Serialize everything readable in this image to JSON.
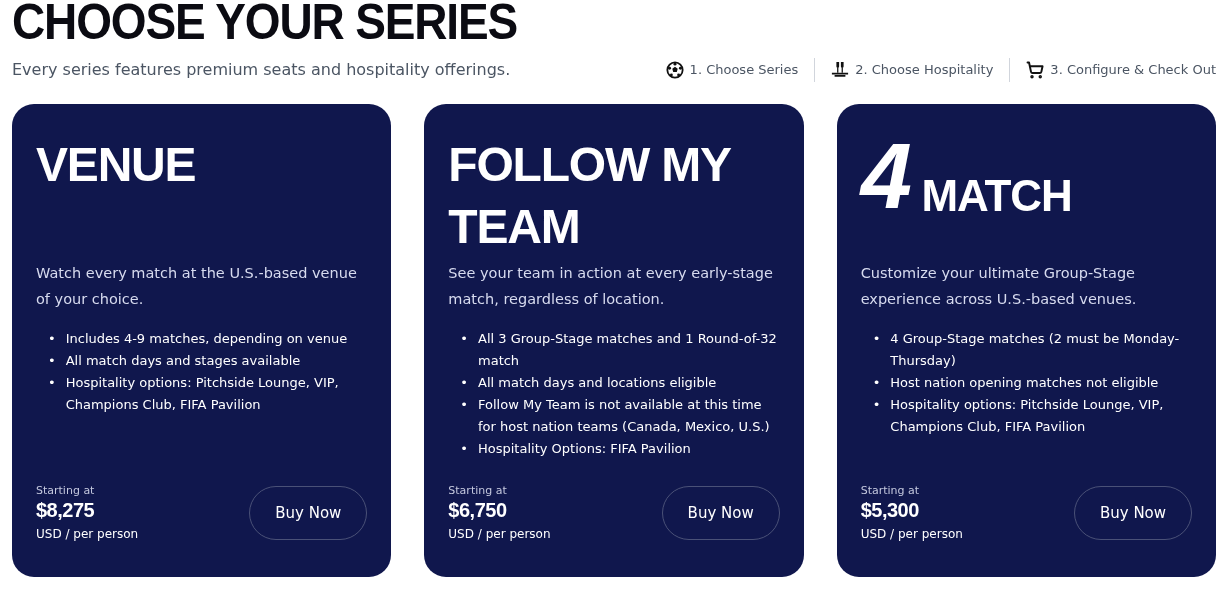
{
  "heading": "CHOOSE YOUR SERIES",
  "bullet": "•",
  "subtitle": "Every series features premium seats and hospitality offerings.",
  "steps": [
    {
      "kind": "ball",
      "label": "1. Choose Series"
    },
    {
      "kind": "glasses",
      "label": "2. Choose Hospitality"
    },
    {
      "kind": "cart",
      "label": "3. Configure & Check Out"
    }
  ],
  "cards": [
    {
      "title": "VENUE",
      "description": "Watch every match at the U.S.-based venue of your choice.",
      "bullets": [
        "Includes 4-9 matches, depending on venue",
        "All match days and stages available",
        "Hospitality options: Pitchside Lounge, VIP, Champions Club, FIFA Pavilion"
      ],
      "price_label": "Starting at",
      "price": "$8,275",
      "price_unit": "USD / per person",
      "button": "Buy Now"
    },
    {
      "title": "FOLLOW MY TEAM",
      "description": "See your team in action at every early-stage match, regardless of location.",
      "bullets": [
        "All 3 Group-Stage matches and 1 Round-of-32 match",
        "All match days and locations eligible",
        "Follow My Team is not available at this time for host nation teams (Canada, Mexico, U.S.)",
        "Hospitality Options: FIFA Pavilion"
      ],
      "price_label": "Starting at",
      "price": "$6,750",
      "price_unit": "USD / per person",
      "button": "Buy Now"
    },
    {
      "number": "4",
      "title": "MATCH",
      "description": "Customize your ultimate Group-Stage experience across U.S.-based venues.",
      "bullets": [
        "4 Group-Stage matches (2 must be Monday-Thursday)",
        "Host nation opening matches not eligible",
        "Hospitality options: Pitchside Lounge, VIP, Champions Club, FIFA Pavilion"
      ],
      "price_label": "Starting at",
      "price": "$5,300",
      "price_unit": "USD / per person",
      "button": "Buy Now"
    }
  ]
}
